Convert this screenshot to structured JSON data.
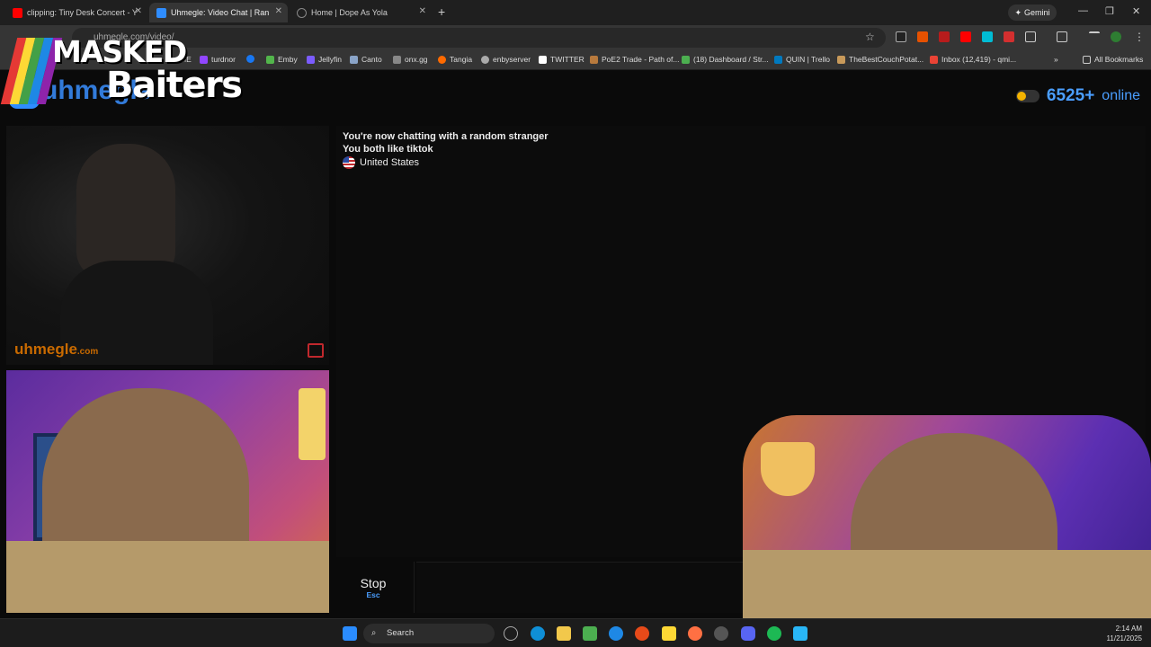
{
  "browser": {
    "tabs": [
      {
        "title": "clipping: Tiny Desk Concert - Y",
        "icon": "youtube-icon",
        "color": "#ff0000"
      },
      {
        "title": "Uhmegle: Video Chat | Ran",
        "icon": "uhmegle-icon",
        "color": "#2f8dff",
        "active": true
      },
      {
        "title": "Home | Dope As Yola",
        "icon": "loading-icon",
        "color": "#888888"
      }
    ],
    "new_tab": "+",
    "gemini_label": "Gemini",
    "address": "uhmegle.com/video/",
    "bookmarks": [
      {
        "label": "ME",
        "color": "#888888"
      },
      {
        "label": "turdnor",
        "color": "#9146ff"
      },
      {
        "label": "",
        "color": "#1877f2"
      },
      {
        "label": "Emby",
        "color": "#52b54b"
      },
      {
        "label": "Jellyfin",
        "color": "#7b5cff"
      },
      {
        "label": "Canto",
        "color": "#8aa4c8"
      },
      {
        "label": "onx.gg",
        "color": "#888888"
      },
      {
        "label": "Tangia",
        "color": "#ff6a00"
      },
      {
        "label": "enbyserver",
        "color": "#aaaaaa"
      },
      {
        "label": "TWITTER",
        "color": "#ffffff"
      },
      {
        "label": "PoE2 Trade - Path of...",
        "color": "#b87a3d"
      },
      {
        "label": "(18) Dashboard / Str...",
        "color": "#4caf50"
      },
      {
        "label": "QUIN | Trello",
        "color": "#0079bf"
      },
      {
        "label": "TheBestCouchPotat...",
        "color": "#c89a5a"
      },
      {
        "label": "Inbox (12,419) - qmi...",
        "color": "#ea4335"
      }
    ],
    "all_bookmarks": "All Bookmarks"
  },
  "overlay": {
    "line1": "MASKED",
    "line2": "Baiters",
    "stripe_colors": [
      "#e53935",
      "#fdd835",
      "#43a047",
      "#1e88e5",
      "#8e24aa"
    ]
  },
  "site": {
    "logo": "uhmegle",
    "online_count": "6525+",
    "online_label": "online",
    "watermark": "uhmegle",
    "watermark_suffix": ".com"
  },
  "chat": {
    "messages": [
      "You're now chatting with a random stranger",
      "You both like tiktok"
    ],
    "country": "United States",
    "stop_label": "Stop",
    "stop_key": "Esc"
  },
  "taskbar": {
    "search_label": "Search",
    "time": "2:14 AM",
    "date": "11/21/2025"
  }
}
